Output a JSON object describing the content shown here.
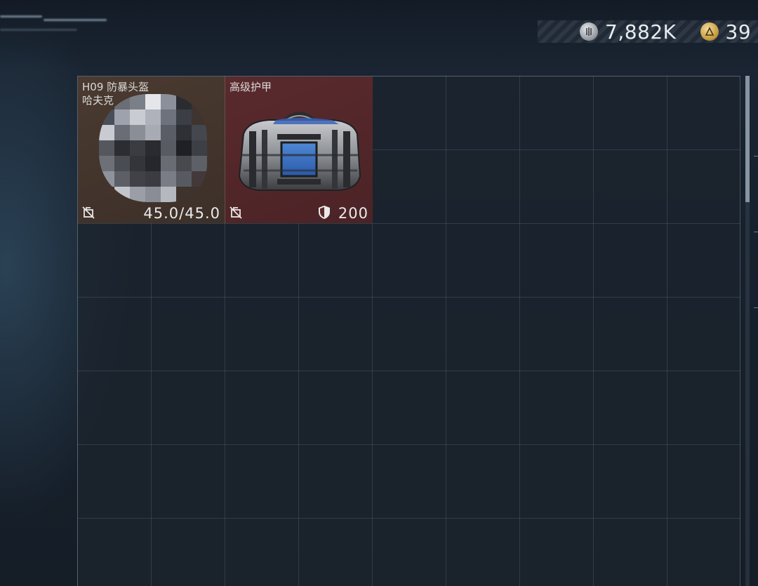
{
  "currency": {
    "silver": {
      "icon": "silver-coin-icon",
      "value": "7,882K"
    },
    "gold": {
      "icon": "gold-coin-icon",
      "value": "39"
    }
  },
  "inventory": {
    "items": [
      {
        "name": "H09 防暴头盔",
        "sub": "哈夫克",
        "stat": "45.0/45.0",
        "icon": "helmet-icon",
        "bind_icon": "no-trade-icon",
        "rarity_color": "#4a3a30"
      },
      {
        "name": "高级护甲",
        "stat": "200",
        "icon": "armored-bag-icon",
        "bind_icon": "no-trade-icon",
        "stat_icon": "shield-icon",
        "rarity_color": "#5a2a2d"
      }
    ]
  }
}
